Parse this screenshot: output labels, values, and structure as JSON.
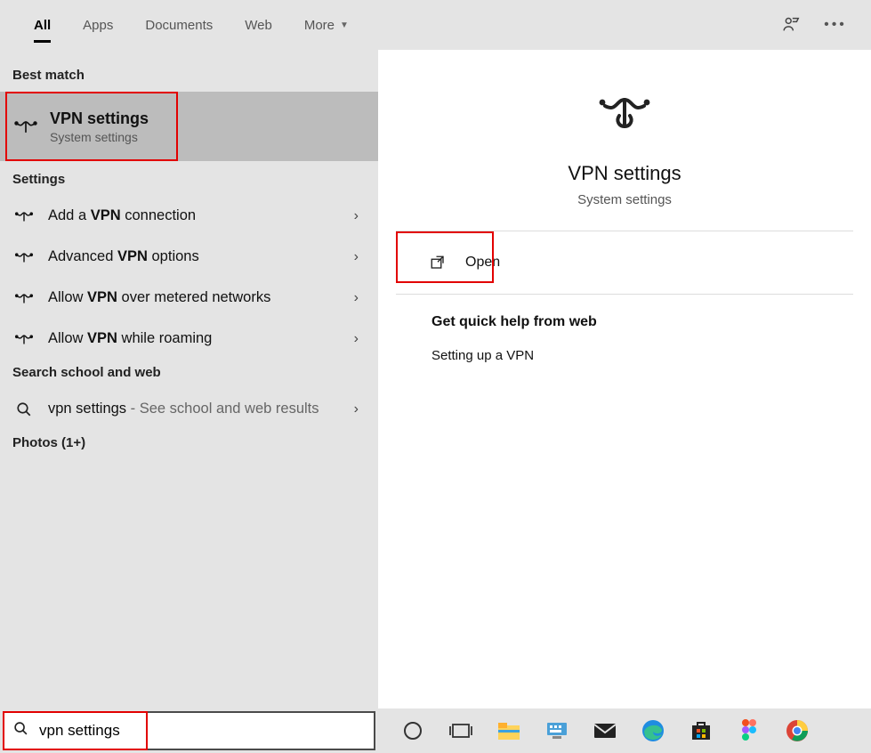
{
  "tabs": {
    "all": "All",
    "apps": "Apps",
    "documents": "Documents",
    "web": "Web",
    "more": "More"
  },
  "left": {
    "best_match_label": "Best match",
    "best_match": {
      "title": "VPN settings",
      "subtitle": "System settings"
    },
    "settings_label": "Settings",
    "settings_rows": [
      {
        "pre": "Add a ",
        "bold": "VPN",
        "post": " connection"
      },
      {
        "pre": "Advanced ",
        "bold": "VPN",
        "post": " options"
      },
      {
        "pre": "Allow ",
        "bold": "VPN",
        "post": " over metered networks"
      },
      {
        "pre": "Allow ",
        "bold": "VPN",
        "post": " while roaming"
      }
    ],
    "search_section_label": "Search school and web",
    "search_row": {
      "query": "vpn settings",
      "suffix": " - See school and web results"
    },
    "photos_label": "Photos (1+)"
  },
  "right": {
    "title": "VPN settings",
    "subtitle": "System settings",
    "open_label": "Open",
    "quick_help_header": "Get quick help from web",
    "quick_help_link": "Setting up a VPN"
  },
  "taskbar": {
    "search_value": "vpn settings",
    "icons": [
      "cortana",
      "task-view",
      "file-explorer",
      "screen-keyboard",
      "mail",
      "edge",
      "microsoft-store",
      "figma",
      "chrome"
    ]
  }
}
